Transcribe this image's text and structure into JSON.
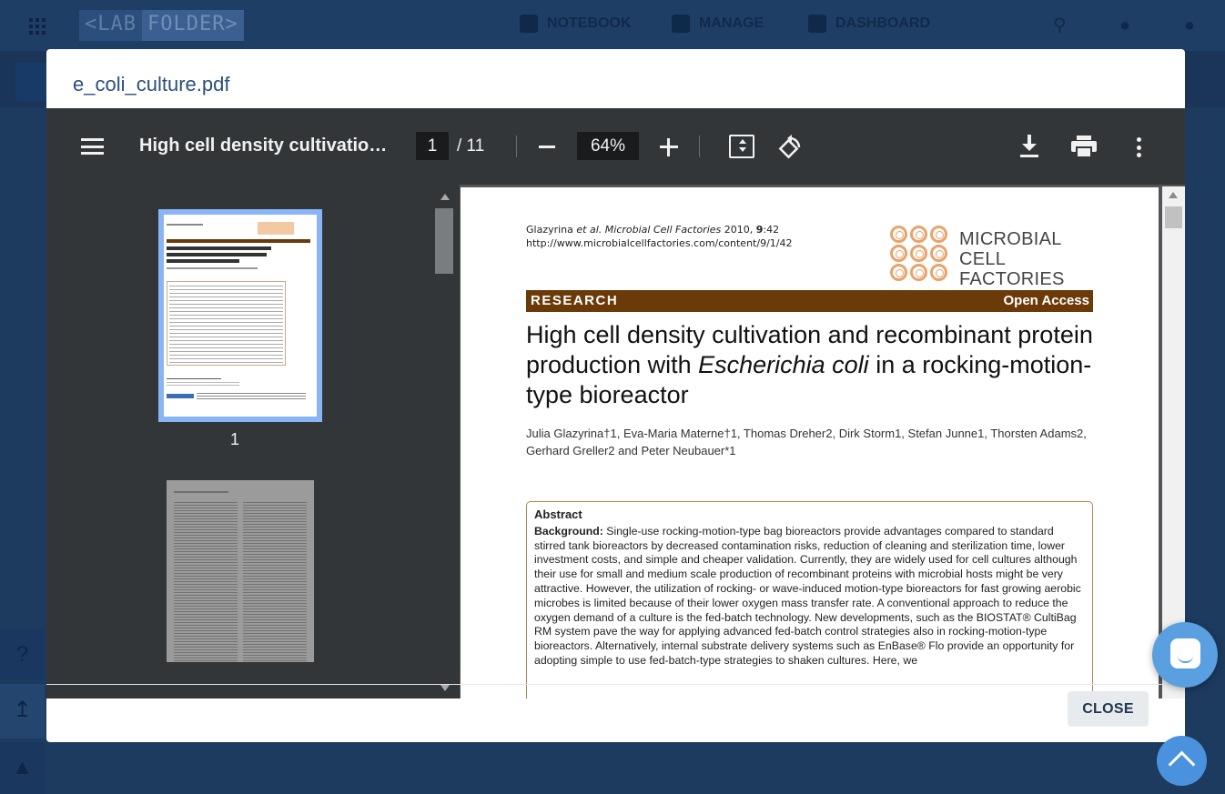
{
  "app": {
    "logo_left": "<LAB",
    "logo_right": "FOLDER>",
    "nav": [
      {
        "label": "NOTEBOOK",
        "icon": "notebook-icon"
      },
      {
        "label": "MANAGE",
        "icon": "briefcase-icon"
      },
      {
        "label": "DASHBOARD",
        "icon": "dashboard-icon"
      }
    ]
  },
  "modal": {
    "title": "e_coli_culture.pdf",
    "close_label": "CLOSE"
  },
  "viewer": {
    "doc_title": "High cell density cultivation and recombinant protein production with Escherichia coli",
    "current_page": "1",
    "total_pages": "/ 11",
    "zoom": "64%",
    "thumb_label": "1"
  },
  "pdf": {
    "citation_line1_a": "Glazyrina ",
    "citation_line1_b": "et al. Microbial Cell Factories",
    "citation_line1_c": " 2010, ",
    "citation_line1_d": "9",
    "citation_line1_e": ":42",
    "citation_line2": "http://www.microbialcellfactories.com/content/9/1/42",
    "journal_name_1": "MICROBIAL CELL",
    "journal_name_2": "FACTORIES",
    "section": "RESEARCH",
    "access": "Open Access",
    "title_a": "High cell density cultivation and recombinant protein production with ",
    "title_b": "Escherichia coli",
    "title_c": " in a rocking-motion-type bioreactor",
    "authors_line1": "Julia Glazyrina†1, Eva-Maria Materne†1, Thomas Dreher2, Dirk Storm1, Stefan Junne1, Thorsten Adams2,",
    "authors_line2": "Gerhard Greller2 and Peter Neubauer*1",
    "abstract_heading": "Abstract",
    "background_label": "Background:",
    "background_text": " Single-use rocking-motion-type bag bioreactors provide advantages compared to standard stirred tank bioreactors by decreased contamination risks, reduction of cleaning and sterilization time, lower investment costs, and simple and cheaper validation. Currently, they are widely used for cell cultures although their use for small and medium scale production of recombinant proteins with microbial hosts might be very attractive. However, the utilization of rocking- or wave-induced motion-type bioreactors for fast growing aerobic microbes is limited because of their lower oxygen mass transfer rate. A conventional approach to reduce the oxygen demand of a culture is the fed-batch technology. New developments, such as the BIOSTAT® CultiBag RM system pave the way for applying advanced fed-batch control strategies also in rocking-motion-type bioreactors. Alternatively, internal substrate delivery systems such as EnBase® Flo provide an opportunity for adopting simple to use fed-batch-type strategies to shaken cultures. Here, we"
  },
  "colors": {
    "modal_title": "#2c4e7c",
    "toolbar": "#323639",
    "research_bar": "#6b3a09",
    "thumb_selected": "#8ab4f8",
    "intercom": "#5a9fe0"
  }
}
